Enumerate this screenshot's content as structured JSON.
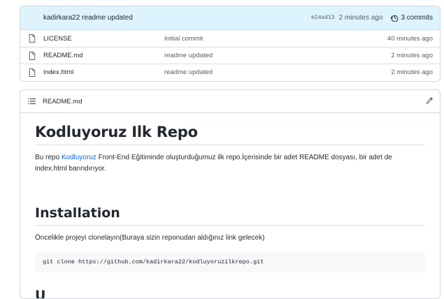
{
  "commit_bar": {
    "author": "kadirkara22",
    "message": "readme updated",
    "sha": "e24ad13",
    "time": "2 minutes ago",
    "commits_label": "3 commits"
  },
  "files": [
    {
      "name": "LICENSE",
      "commit": "Initial commit",
      "time": "40 minutes ago"
    },
    {
      "name": "README.md",
      "commit": "readme updated",
      "time": "2 minutes ago"
    },
    {
      "name": "index.html",
      "commit": "readme updated",
      "time": "2 minutes ago"
    }
  ],
  "readme": {
    "filename": "README.md",
    "h1": "Kodluyoruz Ilk Repo",
    "p1_before": "Bu repo ",
    "p1_link": "Kodluyoruz",
    "p1_after": " Front-End Eğitiminde oluşturduğumuz ilk repo.İçerisinde bir adet README dosyası, bir adet de index.html barındırıyor.",
    "h2_install": "Installation",
    "p2": "Öncelikle projeyi clonelayın(Buraya sizin reponudan aldığınız link gelecek)",
    "code": "git clone https://github.com/kadirkara22/kodluyoruzilkrepo.git",
    "h2_next": "U"
  }
}
